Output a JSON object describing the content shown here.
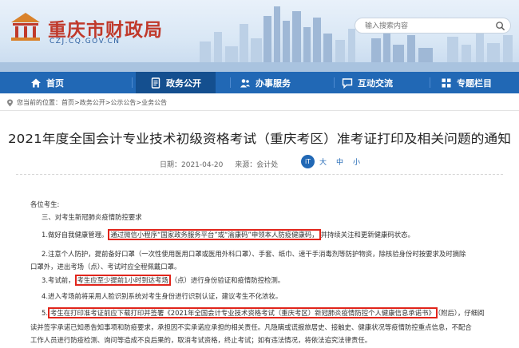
{
  "header": {
    "site_title": "重庆市财政局",
    "site_domain": "CZJ.CQ.GOV.CN",
    "search_placeholder": "输入搜索内容"
  },
  "nav": [
    {
      "label": "首页",
      "icon": "home-icon"
    },
    {
      "label": "政务公开",
      "icon": "document-icon"
    },
    {
      "label": "办事服务",
      "icon": "people-icon"
    },
    {
      "label": "互动交流",
      "icon": "chat-icon"
    },
    {
      "label": "专题栏目",
      "icon": "grid-icon"
    }
  ],
  "breadcrumb": {
    "prefix": "您当前的位置：",
    "items": [
      "首页",
      "政务公开",
      "公示公告",
      "业务公告"
    ],
    "separator": ">"
  },
  "article": {
    "title": "2021年度全国会计专业技术初级资格考试（重庆考区）准考证打印及相关问题的通知",
    "date": "日期：2021-04-20",
    "source": "来源：会计处",
    "font_badge": "iT",
    "font_sizes": [
      "大",
      "中",
      "小"
    ],
    "greeting": "各位考生:",
    "section3": "三、对考生新冠肺炎疫情防控要求",
    "p1_a": "1.做好自我健康管理。",
    "p1_hl": "通过微信小程序“国家政务服务平台”或“渝康码”申领本人防疫健康码，",
    "p1_b": "并持续关注和更新健康码状态。",
    "p2_l1": "2.注意个人防护，提前备好口罩（一次性使用医用口罩或医用外科口罩）、手套、纸巾、速干手消毒剂等防护物资，除核验身份时按要求及时摘除",
    "p2_l2": "口罩外，进出考场（点）、考试时应全程佩戴口罩。",
    "p3_a": "3.考试前，",
    "p3_hl": "考生应至少提前1小时到达考场",
    "p3_b": "（点）进行身份验证和疫情防控检测。",
    "p4": "4.进入考场前将采用人脸识别系统对考生身份进行识别认证，建议考生不化浓妆。",
    "p5_a": "5.",
    "p5_hl": "考生在打印准考证前应下载打印并签署《2021年全国会计专业技术资格考试（重庆考区）新冠肺炎疫情防控个人健康信息承诺书》",
    "p5_b": "（附后），仔细阅",
    "p5_l2": "读并签字承诺已知悉告知事项和防疫要求，承担因不实承诺应承担的相关责任。凡隐瞒或谎报旅居史、接触史、健康状况等疫情防控重点信息，不配合",
    "p5_l3": "工作人员进行防疫检测、询问等造成不良后果的，取消考试资格，终止考试；如有违法情况，将依法追究法律责任。"
  },
  "colors": {
    "nav_bg": "#2168b5",
    "nav_active": "#144f8f",
    "title_red": "#c0392b",
    "highlight_border": "#e1251b"
  }
}
